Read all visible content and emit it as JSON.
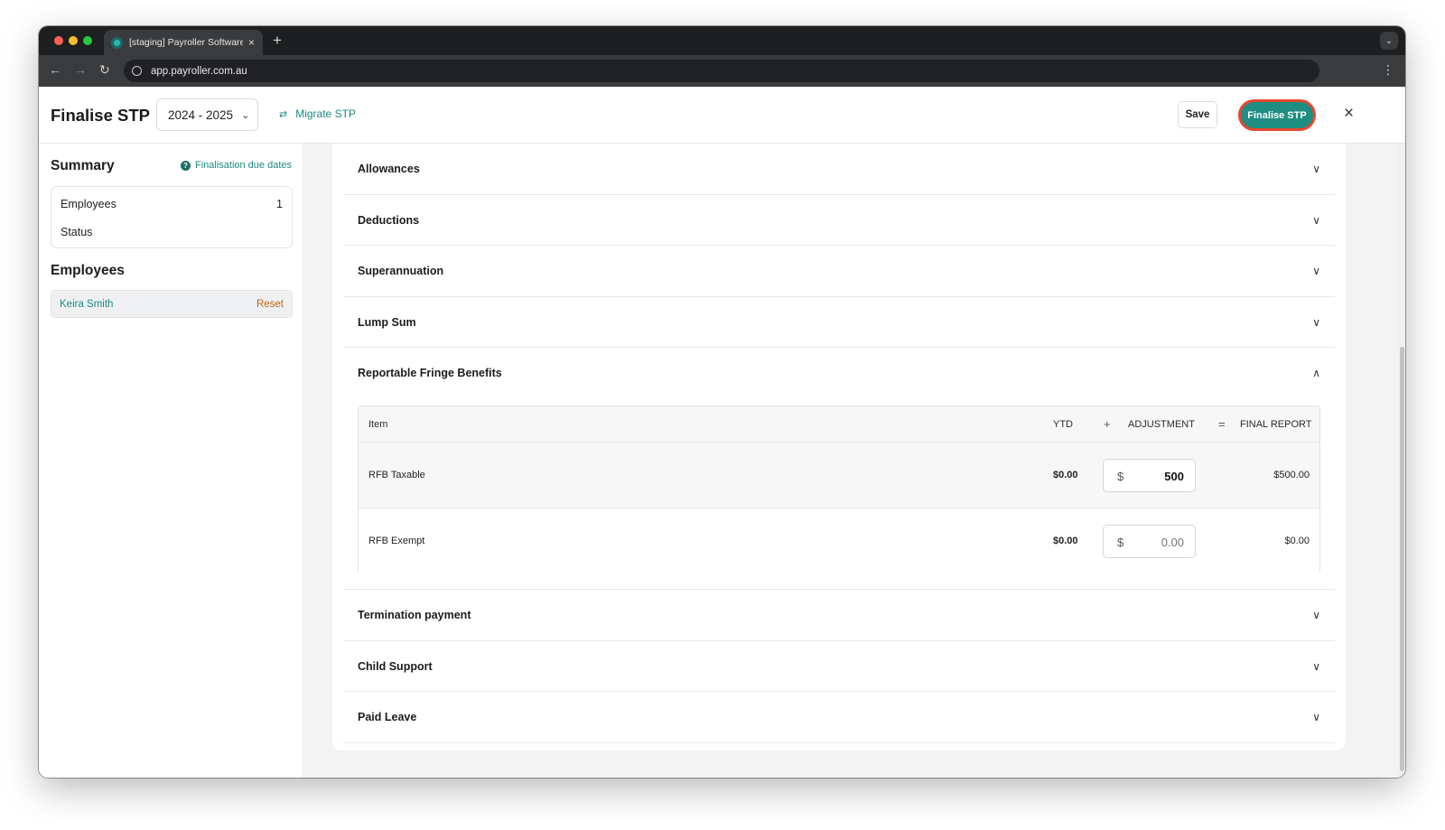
{
  "browser": {
    "tab_title": "[staging] Payroller Software",
    "tab_close": "×",
    "new_tab": "+",
    "url": "app.payroller.com.au"
  },
  "header": {
    "title": "Finalise STP",
    "year_select": "2024 - 2025",
    "migrate_label": "Migrate STP",
    "save_label": "Save",
    "finalise_label": "Finalise STP",
    "close": "×"
  },
  "sidebar": {
    "summary_title": "Summary",
    "due_dates_label": "Finalisation due dates",
    "summary": {
      "employees_label": "Employees",
      "employees_value": "1",
      "status_label": "Status"
    },
    "employees_title": "Employees",
    "employee": {
      "name": "Keira Smith",
      "reset_label": "Reset"
    }
  },
  "sections": {
    "allowances": "Allowances",
    "deductions": "Deductions",
    "superannuation": "Superannuation",
    "lump_sum": "Lump Sum",
    "rfb": "Reportable Fringe Benefits",
    "termination": "Termination payment",
    "child_support": "Child Support",
    "paid_leave": "Paid Leave"
  },
  "rfb_table": {
    "headers": {
      "item": "Item",
      "ytd": "YTD",
      "plus": "+",
      "adjustment": "ADJUSTMENT",
      "equals": "=",
      "final_report": "FINAL REPORT"
    },
    "rows": [
      {
        "item": "RFB Taxable",
        "ytd": "$0.00",
        "currency": "$",
        "adjustment": "500",
        "final": "$500.00"
      },
      {
        "item": "RFB Exempt",
        "ytd": "$0.00",
        "currency": "$",
        "adjustment": "0.00",
        "final": "$0.00"
      }
    ]
  }
}
